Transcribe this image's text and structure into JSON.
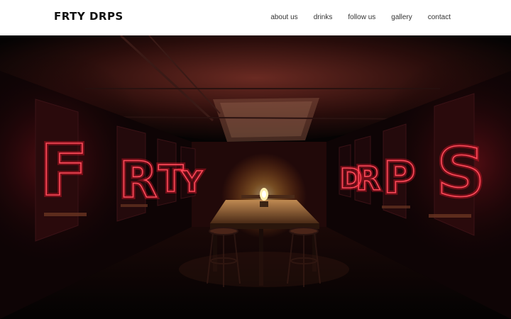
{
  "header": {
    "logo": "FRTY DRPS",
    "nav": [
      {
        "label": "about us"
      },
      {
        "label": "drinks"
      },
      {
        "label": "follow us"
      },
      {
        "label": "gallery"
      },
      {
        "label": "contact"
      }
    ]
  },
  "hero": {
    "neon_letters_left": [
      "F",
      "R",
      "T",
      "Y"
    ],
    "neon_letters_right": [
      "D",
      "R",
      "P",
      "S"
    ],
    "colors": {
      "neon": "#ff4a5a",
      "background": "#050303",
      "lamp": "#ffd27a"
    }
  }
}
